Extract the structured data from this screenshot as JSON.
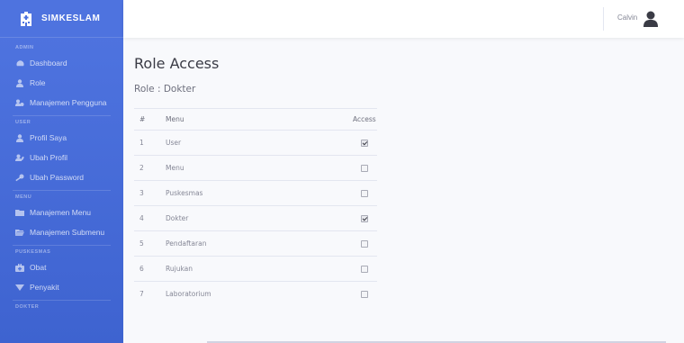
{
  "brand": {
    "name": "SIMKESLAM"
  },
  "sidebar": {
    "sections": [
      {
        "heading": "ADMIN",
        "items": [
          {
            "label": "Dashboard",
            "icon": "dashboard-icon"
          },
          {
            "label": "Role",
            "icon": "user-icon"
          },
          {
            "label": "Manajemen Pengguna",
            "icon": "users-cog-icon"
          }
        ]
      },
      {
        "heading": "USER",
        "items": [
          {
            "label": "Profil Saya",
            "icon": "user-icon"
          },
          {
            "label": "Ubah Profil",
            "icon": "user-edit-icon"
          },
          {
            "label": "Ubah Password",
            "icon": "key-icon"
          }
        ]
      },
      {
        "heading": "MENU",
        "items": [
          {
            "label": "Manajemen Menu",
            "icon": "folder-icon"
          },
          {
            "label": "Manajemen Submenu",
            "icon": "folder-open-icon"
          }
        ]
      },
      {
        "heading": "PUSKESMAS",
        "items": [
          {
            "label": "Obat",
            "icon": "medkit-icon"
          },
          {
            "label": "Penyakit",
            "icon": "virus-icon"
          }
        ]
      },
      {
        "heading": "DOKTER",
        "items": []
      }
    ]
  },
  "topbar": {
    "username": "Calvin"
  },
  "page": {
    "title": "Role Access",
    "role_line": "Role : Dokter"
  },
  "table": {
    "headers": [
      "#",
      "Menu",
      "Access"
    ],
    "rows": [
      {
        "num": "1",
        "menu": "User",
        "checked": true
      },
      {
        "num": "2",
        "menu": "Menu",
        "checked": false
      },
      {
        "num": "3",
        "menu": "Puskesmas",
        "checked": false
      },
      {
        "num": "4",
        "menu": "Dokter",
        "checked": true
      },
      {
        "num": "5",
        "menu": "Pendaftaran",
        "checked": false
      },
      {
        "num": "6",
        "menu": "Rujukan",
        "checked": false
      },
      {
        "num": "7",
        "menu": "Laboratorium",
        "checked": false
      }
    ]
  },
  "colors": {
    "sidebar": "#4e73df",
    "background": "#f8f9fc",
    "text": "#858796"
  }
}
